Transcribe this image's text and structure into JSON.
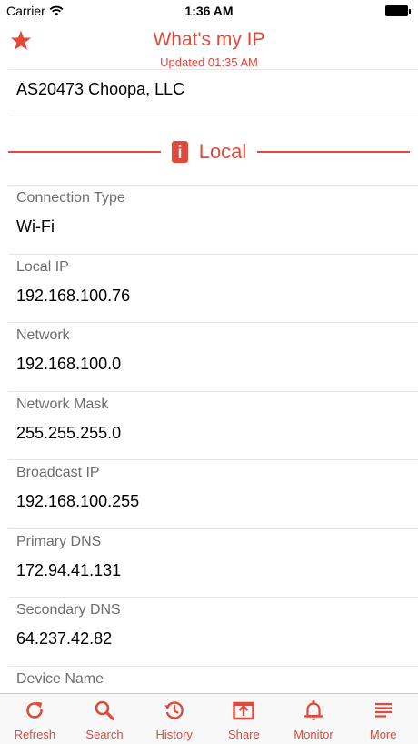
{
  "status_bar": {
    "carrier": "Carrier",
    "time": "1:36 AM"
  },
  "nav": {
    "title": "What's my IP",
    "subtitle": "Updated 01:35 AM"
  },
  "isp": {
    "value": "AS20473 Choopa, LLC"
  },
  "section": {
    "title": "Local"
  },
  "rows": [
    {
      "label": "Connection Type",
      "value": "Wi-Fi"
    },
    {
      "label": "Local IP",
      "value": "192.168.100.76"
    },
    {
      "label": "Network",
      "value": "192.168.100.0"
    },
    {
      "label": "Network Mask",
      "value": "255.255.255.0"
    },
    {
      "label": "Broadcast IP",
      "value": "192.168.100.255"
    },
    {
      "label": "Primary DNS",
      "value": "172.94.41.131"
    },
    {
      "label": "Secondary DNS",
      "value": "64.237.42.82"
    },
    {
      "label": "Device Name",
      "value": ""
    }
  ],
  "tabs": [
    {
      "label": "Refresh",
      "icon": "refresh-icon"
    },
    {
      "label": "Search",
      "icon": "search-icon"
    },
    {
      "label": "History",
      "icon": "history-icon"
    },
    {
      "label": "Share",
      "icon": "share-icon"
    },
    {
      "label": "Monitor",
      "icon": "bell-icon"
    },
    {
      "label": "More",
      "icon": "menu-lines-icon"
    }
  ],
  "colors": {
    "accent": "#e0493b",
    "secondary_text": "#6d6d72",
    "separator": "#e6e6e6"
  }
}
